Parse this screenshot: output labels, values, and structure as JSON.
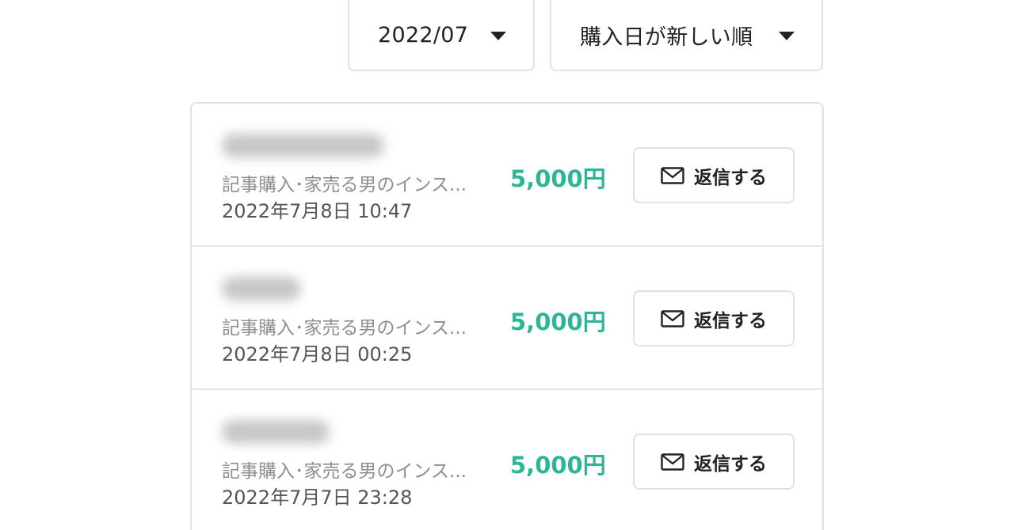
{
  "filters": {
    "month": {
      "value": "2022/07",
      "icon": "caret-down-icon"
    },
    "sort": {
      "value": "購入日が新しい順",
      "icon": "caret-down-icon"
    }
  },
  "colors": {
    "price": "#2cb696",
    "border": "#e1e1e1",
    "muted_text": "#8e8e8e"
  },
  "sales": [
    {
      "item": "記事購入･家売る男のインス...",
      "date": "2022年7月8日 10:47",
      "price": "5,000円",
      "reply_label": "返信する",
      "reply_icon": "mail-icon"
    },
    {
      "item": "記事購入･家売る男のインス...",
      "date": "2022年7月8日 00:25",
      "price": "5,000円",
      "reply_label": "返信する",
      "reply_icon": "mail-icon"
    },
    {
      "item": "記事購入･家売る男のインス...",
      "date": "2022年7月7日 23:28",
      "price": "5,000円",
      "reply_label": "返信する",
      "reply_icon": "mail-icon"
    }
  ]
}
